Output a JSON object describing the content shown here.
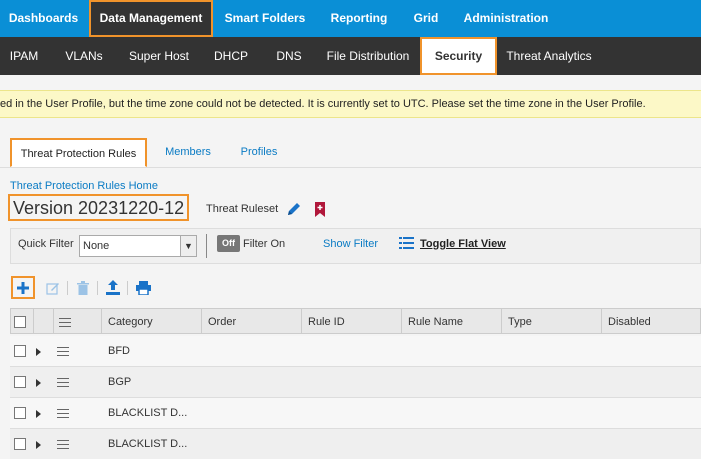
{
  "topnav": {
    "items": [
      {
        "label": "Dashboards"
      },
      {
        "label": "Data Management"
      },
      {
        "label": "Smart Folders"
      },
      {
        "label": "Reporting"
      },
      {
        "label": "Grid"
      },
      {
        "label": "Administration"
      }
    ]
  },
  "subnav": {
    "items": [
      {
        "label": "IPAM"
      },
      {
        "label": "VLANs"
      },
      {
        "label": "Super Host"
      },
      {
        "label": "DHCP"
      },
      {
        "label": "DNS"
      },
      {
        "label": "File Distribution"
      },
      {
        "label": "Security"
      },
      {
        "label": "Threat Analytics"
      }
    ]
  },
  "banner": {
    "text": "ed in the User Profile, but the time zone could not be detected. It is currently set to UTC. Please set the time zone in the User Profile."
  },
  "tabs": [
    {
      "label": "Threat Protection Rules"
    },
    {
      "label": "Members"
    },
    {
      "label": "Profiles"
    }
  ],
  "breadcrumb": "Threat Protection Rules Home",
  "title": "Version 20231220-12",
  "ruleset_label": "Threat Ruleset",
  "filter": {
    "quick_filter_label": "Quick Filter",
    "quick_filter_value": "None",
    "toggle_label": "Off",
    "filter_on_label": "Filter On",
    "show_filter": "Show Filter",
    "toggle_flat_view": "Toggle Flat View"
  },
  "toolbar": {
    "icons": [
      "add-icon",
      "edit-icon",
      "delete-icon",
      "export-icon",
      "print-icon"
    ]
  },
  "table": {
    "columns": [
      "Category",
      "Order",
      "Rule ID",
      "Rule Name",
      "Type",
      "Disabled"
    ],
    "rows": [
      {
        "category": "BFD"
      },
      {
        "category": "BGP"
      },
      {
        "category": "BLACKLIST D..."
      },
      {
        "category": "BLACKLIST D..."
      }
    ]
  },
  "colors": {
    "brand": "#0a8fd6",
    "highlight": "#f0932b",
    "link": "#0a7bc4",
    "banner": "#fcf8c7"
  }
}
